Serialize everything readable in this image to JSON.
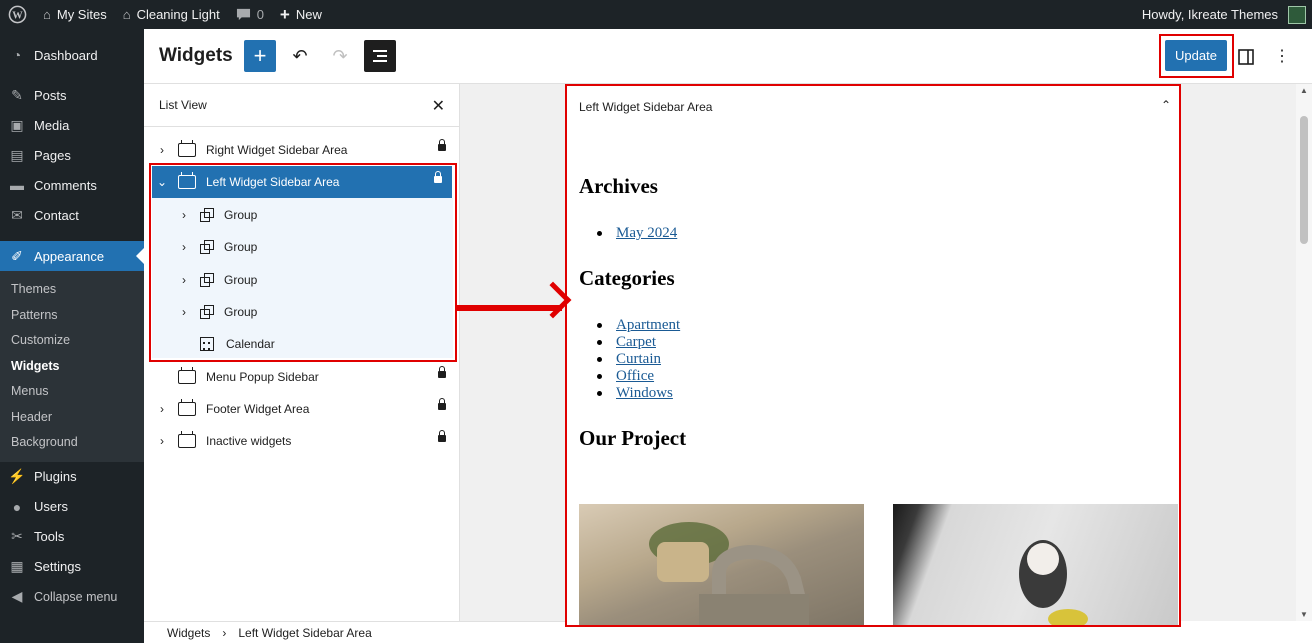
{
  "adminbar": {
    "my_sites": "My Sites",
    "site_name": "Cleaning Light",
    "comments_count": "0",
    "new_label": "New",
    "howdy": "Howdy, Ikreate Themes"
  },
  "sidebar": {
    "items": [
      {
        "label": "Dashboard",
        "icon": "dashboard-icon"
      },
      {
        "label": "Posts",
        "icon": "pin-icon"
      },
      {
        "label": "Media",
        "icon": "media-icon"
      },
      {
        "label": "Pages",
        "icon": "pages-icon"
      },
      {
        "label": "Comments",
        "icon": "comment-icon"
      },
      {
        "label": "Contact",
        "icon": "mail-icon"
      },
      {
        "label": "Appearance",
        "icon": "brush-icon"
      },
      {
        "label": "Plugins",
        "icon": "plugin-icon"
      },
      {
        "label": "Users",
        "icon": "user-icon"
      },
      {
        "label": "Tools",
        "icon": "wrench-icon"
      },
      {
        "label": "Settings",
        "icon": "settings-icon"
      },
      {
        "label": "Collapse menu",
        "icon": "collapse-icon"
      }
    ],
    "submenu": [
      "Themes",
      "Patterns",
      "Customize",
      "Widgets",
      "Menus",
      "Header",
      "Background"
    ],
    "current_submenu": "Widgets"
  },
  "header": {
    "title": "Widgets",
    "update_label": "Update"
  },
  "list_view": {
    "title": "List View",
    "rows": [
      {
        "label": "Right Widget Sidebar Area"
      },
      {
        "label": "Left Widget Sidebar Area"
      },
      {
        "label": "Group"
      },
      {
        "label": "Group"
      },
      {
        "label": "Group"
      },
      {
        "label": "Group"
      },
      {
        "label": "Calendar"
      },
      {
        "label": "Menu Popup Sidebar"
      },
      {
        "label": "Footer Widget Area"
      },
      {
        "label": "Inactive widgets"
      }
    ]
  },
  "preview": {
    "area_title": "Left Widget Sidebar Area",
    "archives_heading": "Archives",
    "archives": [
      "May 2024"
    ],
    "categories_heading": "Categories",
    "categories": [
      "Apartment",
      "Carpet",
      "Curtain",
      "Office",
      "Windows"
    ],
    "project_heading": "Our Project"
  },
  "breadcrumb": {
    "root": "Widgets",
    "current": "Left Widget Sidebar Area"
  },
  "colors": {
    "admin_dark": "#1d2327",
    "accent": "#2271b1",
    "highlight": "#e00000"
  }
}
